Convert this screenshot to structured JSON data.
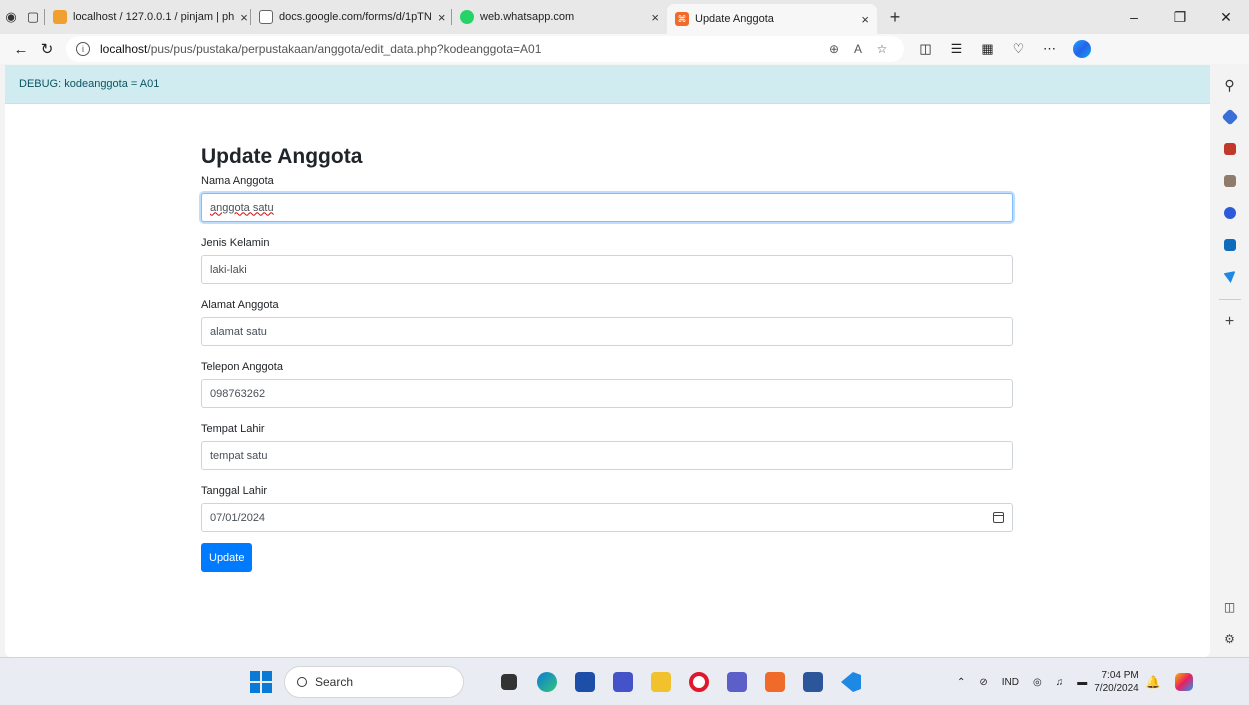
{
  "browser": {
    "tabs": [
      {
        "title": "localhost / 127.0.0.1 / pinjam | ph",
        "close": "×"
      },
      {
        "title": "docs.google.com/forms/d/1pTN",
        "close": "×"
      },
      {
        "title": "web.whatsapp.com",
        "close": "×"
      },
      {
        "title": "Update Anggota",
        "close": "×",
        "active": true
      }
    ],
    "new_tab": "+",
    "url_host": "localhost",
    "url_path": "/pus/pus/pustaka/perpustakaan/anggota/edit_data.php?kodeanggota=A01",
    "colors": {
      "accent": "#007bff",
      "debug_bg": "#d1ecf1",
      "debug_text": "#0c5460"
    }
  },
  "page": {
    "debug": "DEBUG: kodeanggota = A01",
    "title": "Update Anggota",
    "fields": [
      {
        "label": "Nama Anggota",
        "value": "anggota satu"
      },
      {
        "label": "Jenis Kelamin",
        "value": "laki-laki"
      },
      {
        "label": "Alamat Anggota",
        "value": "alamat satu"
      },
      {
        "label": "Telepon Anggota",
        "value": "098763262"
      },
      {
        "label": "Tempat Lahir",
        "value": "tempat satu"
      },
      {
        "label": "Tanggal Lahir",
        "value": "07/01/2024"
      }
    ],
    "submit": "Update"
  },
  "taskbar": {
    "search": "Search",
    "lang": "IND",
    "time": "7:04 PM",
    "date": "7/20/2024"
  }
}
